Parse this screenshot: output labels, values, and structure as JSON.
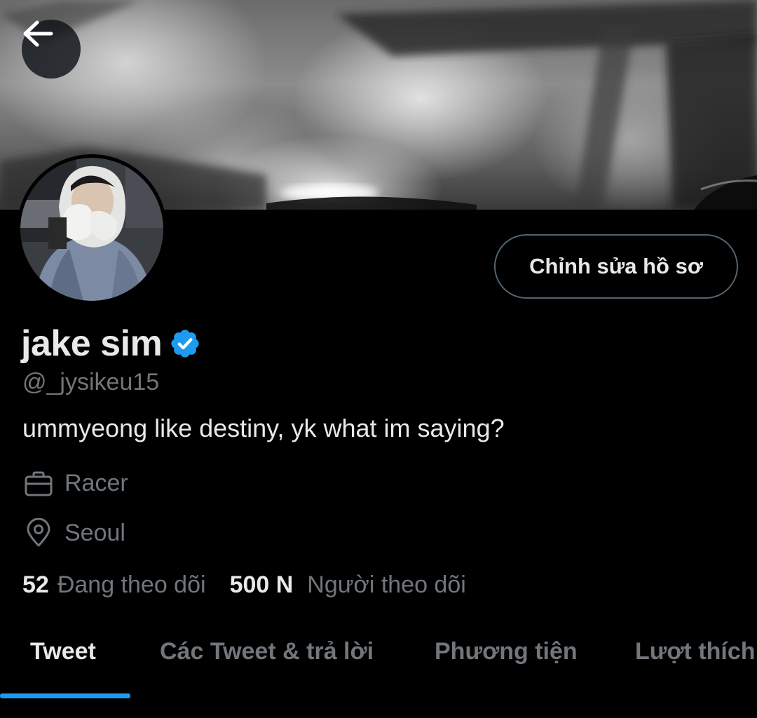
{
  "header": {
    "back_label": "Back"
  },
  "profile": {
    "edit_button_label": "Chỉnh sửa hồ sơ",
    "display_name": "jake sim",
    "verified": true,
    "handle": "@_jysikeu15",
    "bio": "ummyeong like destiny, yk what im saying?",
    "job": "Racer",
    "location": "Seoul",
    "following_count": "52",
    "following_label": "Đang theo dõi",
    "followers_count": "500 N",
    "followers_label": "Người theo dõi"
  },
  "tabs": [
    {
      "label": "Tweet",
      "active": true
    },
    {
      "label": "Các Tweet & trả lời",
      "active": false
    },
    {
      "label": "Phương tiện",
      "active": false
    },
    {
      "label": "Lượt thích",
      "active": false
    }
  ],
  "colors": {
    "background": "#000000",
    "accent": "#1d9bf0",
    "text_primary": "#e7e9ea",
    "text_secondary": "#71767b",
    "border": "#536471"
  },
  "icons": {
    "back": "arrow-left-icon",
    "verified": "verified-badge-icon",
    "job": "briefcase-icon",
    "location": "location-pin-icon"
  }
}
